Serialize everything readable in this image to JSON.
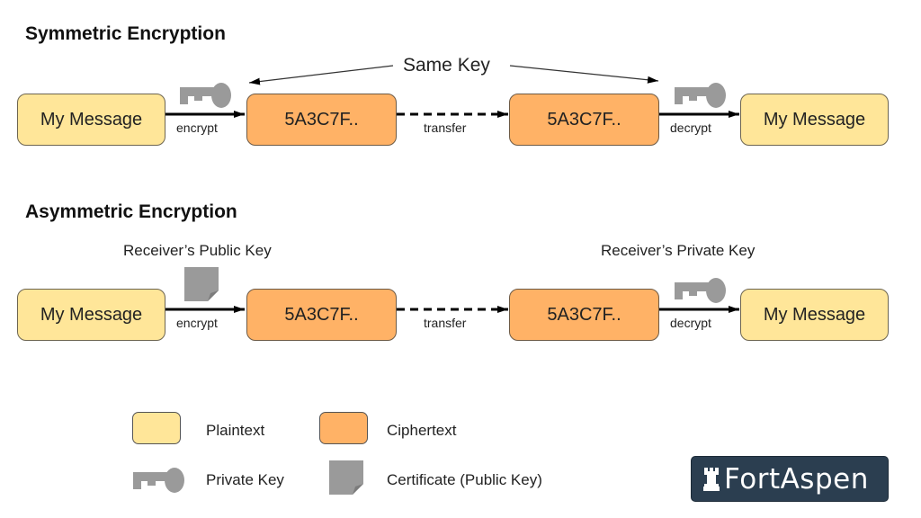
{
  "colors": {
    "plaintext": "#ffe699",
    "ciphertext": "#ffb266",
    "icon_gray": "#9a9a9a",
    "logo_bg": "#2b3e50"
  },
  "symmetric": {
    "title": "Symmetric Encryption",
    "same_key_label": "Same Key",
    "nodes": [
      "My Message",
      "5A3C7F..",
      "5A3C7F..",
      "My Message"
    ],
    "edges": [
      "encrypt",
      "transfer",
      "decrypt"
    ]
  },
  "asymmetric": {
    "title": "Asymmetric Encryption",
    "public_key_label": "Receiver’s Public Key",
    "private_key_label": "Receiver’s Private Key",
    "nodes": [
      "My Message",
      "5A3C7F..",
      "5A3C7F..",
      "My Message"
    ],
    "edges": [
      "encrypt",
      "transfer",
      "decrypt"
    ]
  },
  "legend": {
    "plaintext": "Plaintext",
    "ciphertext": "Ciphertext",
    "private_key": "Private Key",
    "certificate": "Certificate (Public Key)"
  },
  "logo": {
    "text": "FortAspen",
    "icon": "rook-icon"
  }
}
